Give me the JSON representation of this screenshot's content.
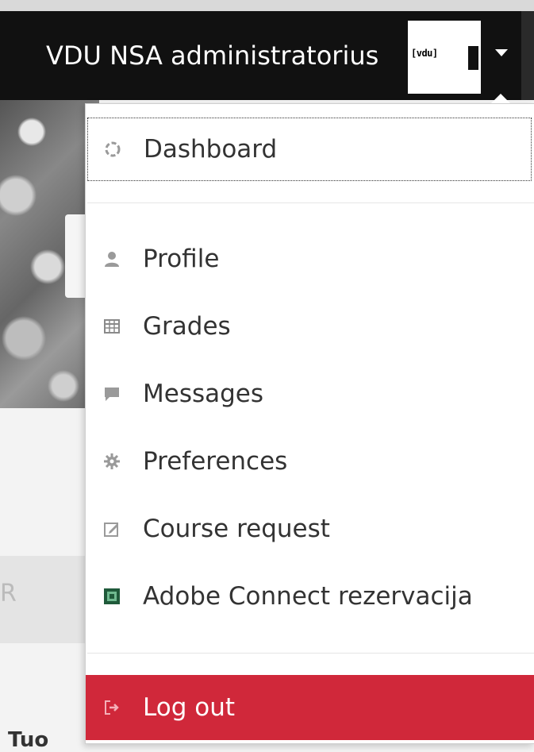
{
  "navbar": {
    "user_name": "VDU NSA administratorius",
    "avatar_text": "[vdu]"
  },
  "menu": {
    "items": [
      {
        "label": "Dashboard",
        "icon": "dashboard-icon"
      },
      {
        "label": "Profile",
        "icon": "user-icon"
      },
      {
        "label": "Grades",
        "icon": "grades-table-icon"
      },
      {
        "label": "Messages",
        "icon": "speech-bubble-icon"
      },
      {
        "label": "Preferences",
        "icon": "gear-icon"
      },
      {
        "label": "Course request",
        "icon": "edit-icon"
      },
      {
        "label": "Adobe Connect rezervacija",
        "icon": "adobe-connect-icon"
      }
    ],
    "logout": {
      "label": "Log out",
      "icon": "logout-icon"
    }
  },
  "background": {
    "partial_letter": "R",
    "partial_bottom_text": "Tuo"
  },
  "colors": {
    "navbar": "#111111",
    "logout_bg": "#d0283a",
    "menu_text": "#333333"
  }
}
